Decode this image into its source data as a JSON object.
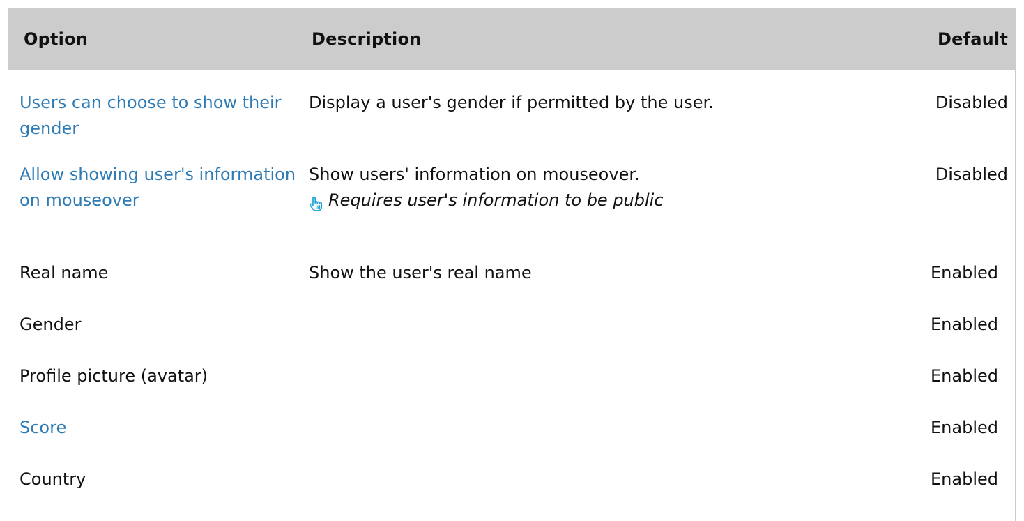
{
  "table": {
    "headers": {
      "option": "Option",
      "description": "Description",
      "default": "Default"
    },
    "rows": [
      {
        "option": "Users can choose to show their gender",
        "option_is_link": true,
        "description": "Display a user's gender if permitted by the user.",
        "note": "",
        "default": "Disabled"
      },
      {
        "option": "Allow showing user's information on mouseover",
        "option_is_link": true,
        "description": "Show users' information on mouseover.",
        "note": "Requires user's information to be public",
        "note_icon": "pointing-hand-icon",
        "default": "Disabled"
      },
      {
        "option": "Real name",
        "option_is_link": false,
        "description": "Show the user's real name",
        "note": "",
        "default": "Enabled"
      },
      {
        "option": "Gender",
        "option_is_link": false,
        "description": "",
        "note": "",
        "default": "Enabled"
      },
      {
        "option": "Profile picture (avatar)",
        "option_is_link": false,
        "description": "",
        "note": "",
        "default": "Enabled"
      },
      {
        "option": "Score",
        "option_is_link": true,
        "description": "",
        "note": "",
        "default": "Enabled"
      },
      {
        "option": "Country",
        "option_is_link": false,
        "description": "",
        "note": "",
        "default": "Enabled"
      }
    ]
  },
  "colors": {
    "header_bg": "#cccccc",
    "link": "#2e7bb5",
    "text": "#111111",
    "icon": "#19a3d6"
  }
}
